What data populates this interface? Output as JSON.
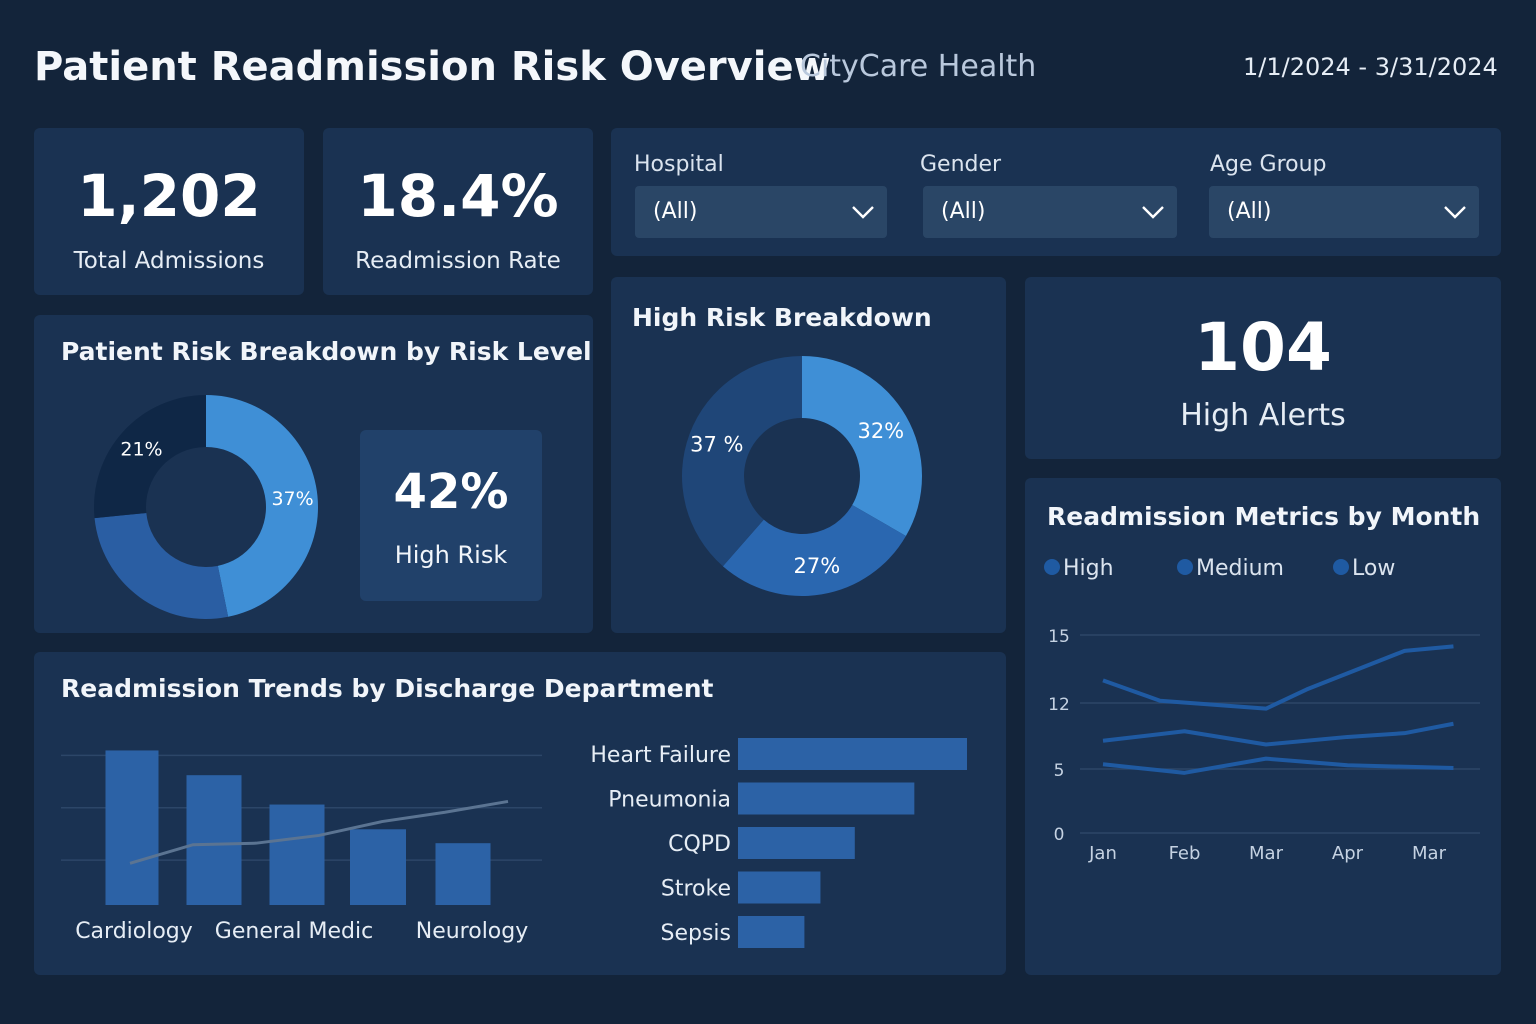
{
  "header": {
    "title": "Patient Readmission Risk Overview",
    "organization": "CityCare Health",
    "date_range": "1/1/2024 - 3/31/2024"
  },
  "kpis": {
    "total_admissions": {
      "value": "1,202",
      "label": "Total Admissions"
    },
    "readmission_rate": {
      "value": "18.4%",
      "label": "Readmission Rate"
    },
    "high_alerts": {
      "value": "104",
      "label": "High Alerts"
    }
  },
  "filters": [
    {
      "label": "Hospital",
      "value": "(All)"
    },
    {
      "label": "Gender",
      "value": "(All)"
    },
    {
      "label": "Age Group",
      "value": "(All)"
    }
  ],
  "risk_breakdown": {
    "title": "Patient Risk Breakdown by Risk Level",
    "highlight": {
      "value": "42%",
      "label": "High Risk"
    }
  },
  "high_risk_breakdown": {
    "title": "High Risk Breakdown"
  },
  "dept_trends": {
    "title": "Readmission Trends by Discharge Department"
  },
  "monthly_metrics": {
    "title": "Readmission Metrics by Month"
  },
  "colors": {
    "background": "#13243a",
    "card": "#1a3252",
    "navy": "#0f2746",
    "dark_blue": "#1f4e8a",
    "mid_blue": "#2a67b0",
    "light_blue": "#3f8fd6",
    "bar": "#2c62a6"
  },
  "chart_data": [
    {
      "type": "pie",
      "labels": [
        "37%",
        "",
        "21%"
      ],
      "values": [
        37,
        21,
        21
      ],
      "colors": [
        "#3f8fd6",
        "#2a5ea3",
        "#0f2746"
      ],
      "title": "Patient Risk Breakdown by Risk Level"
    },
    {
      "type": "pie",
      "labels": [
        "32%",
        "27%",
        "37 %"
      ],
      "values": [
        32,
        27,
        37
      ],
      "colors": [
        "#3f8fd6",
        "#2a67b0",
        "#1f4678"
      ],
      "title": "High Risk Breakdown"
    },
    {
      "type": "bar",
      "title": "Readmission Trends by Discharge Department",
      "categories": [
        "Cardiology",
        "",
        "General Medic",
        "",
        "Neurology"
      ],
      "values": [
        100,
        84,
        65,
        49,
        40
      ],
      "trend": [
        27,
        39,
        40,
        45,
        54,
        60,
        67
      ],
      "ylim": [
        0,
        110
      ],
      "grid": true
    },
    {
      "type": "bar",
      "orientation": "horizontal",
      "categories": [
        "Heart Failure",
        "Pneumonia",
        "CQPD",
        "Stroke",
        "Sepsis"
      ],
      "values": [
        100,
        77,
        51,
        36,
        29
      ]
    },
    {
      "type": "line",
      "title": "Readmission Metrics by Month",
      "legend": [
        "High",
        "Medium",
        "Low"
      ],
      "legend_position": "top-left",
      "x": [
        "Jan",
        "Feb",
        "Mar",
        "Apr",
        "Mar"
      ],
      "y_ticks": [
        "15",
        "12",
        "5",
        "0"
      ],
      "series": [
        {
          "name": "High",
          "x": [
            0,
            0.7,
            2,
            2.5,
            3.7,
            4.3
          ],
          "values": [
            13,
            12.1,
            11.4,
            12.6,
            14.3,
            14.5
          ]
        },
        {
          "name": "Medium",
          "x": [
            0,
            1,
            2,
            3,
            3.7,
            4.3
          ],
          "values": [
            8,
            9,
            7.6,
            8.4,
            8.8,
            9.8
          ]
        },
        {
          "name": "Low",
          "x": [
            0,
            1,
            2,
            3,
            4.3
          ],
          "values": [
            5.5,
            4.7,
            6.1,
            5.4,
            5.1
          ]
        }
      ],
      "grid": true
    }
  ]
}
